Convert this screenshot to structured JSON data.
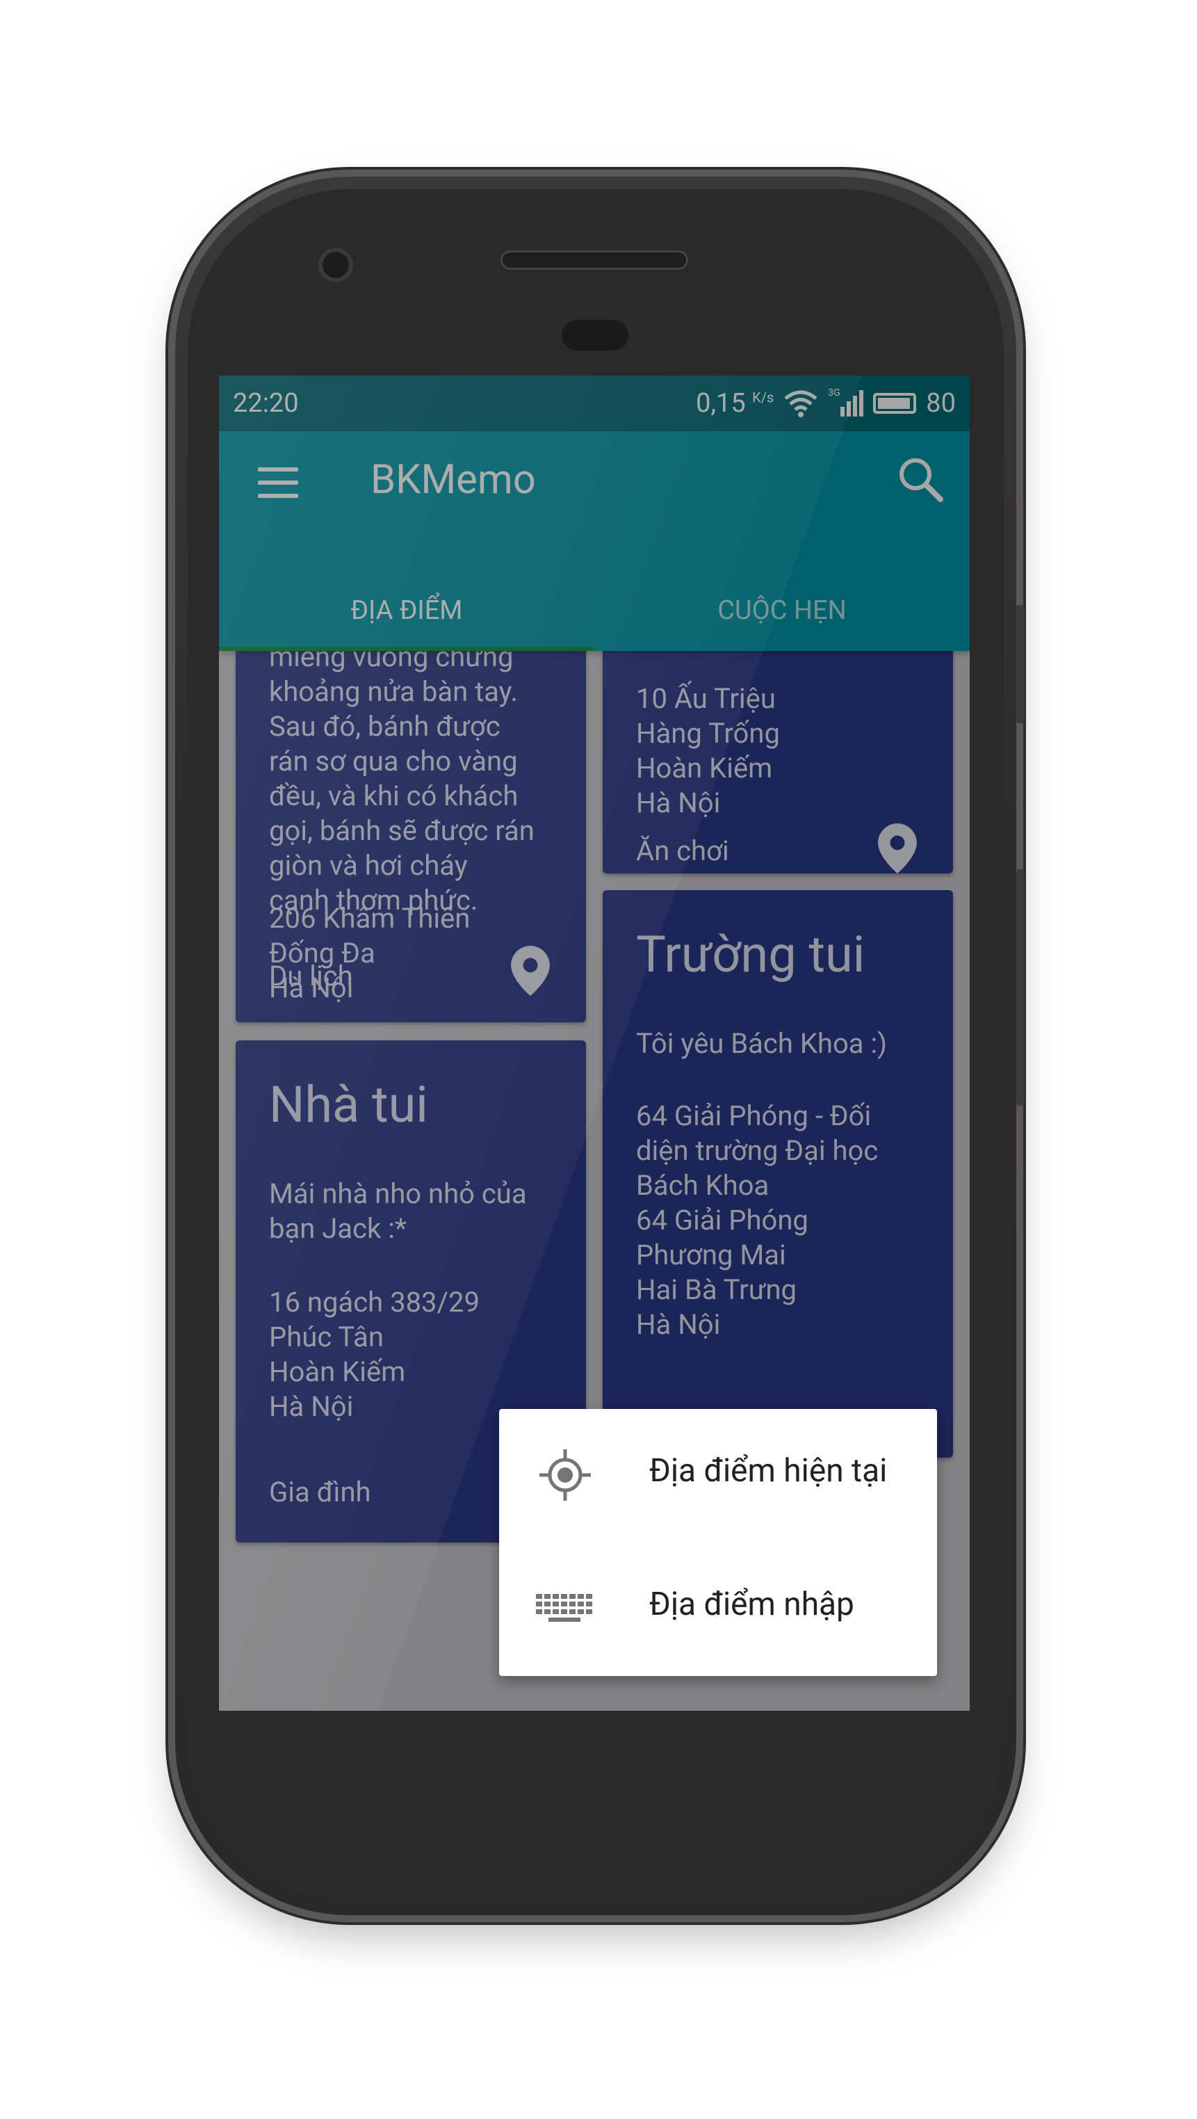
{
  "status_bar": {
    "time": "22:20",
    "speed": "0,15",
    "speed_unit": "K/s",
    "network": "3G",
    "battery": "80"
  },
  "app_bar": {
    "title": "BKMemo"
  },
  "tabs": [
    {
      "label": "ĐỊA ĐIỂM"
    },
    {
      "label": "CUỘC HẸN"
    }
  ],
  "cards": [
    {
      "description": "miếng vuông chừng\nkhoảng nửa bàn tay.\nSau đó, bánh được\nrán sơ qua cho vàng\nđều, và khi có khách\ngọi, bánh sẽ được rán\ngiòn và hơi cháy\ncạnh thơm phức.",
      "address": "206 Khâm Thiên\nĐống Đa\nHà Nội",
      "category": "Du lịch"
    },
    {
      "address": "10 Ấu Triệu\nHàng Trống\nHoàn Kiếm\nHà Nội",
      "category": "Ăn chơi"
    },
    {
      "title": "Nhà tui",
      "description": "Mái nhà nho nhỏ của\nbạn Jack :*",
      "address": "16 ngách 383/29\nPhúc Tân\nHoàn Kiếm\nHà Nội",
      "category": "Gia đình"
    },
    {
      "title": "Trường tui",
      "description": "Tôi yêu Bách Khoa :)",
      "address": "64 Giải Phóng - Đối\ndiện trường Đại học\nBách Khoa\n64 Giải Phóng\nPhương Mai\nHai Bà Trưng\nHà Nội"
    }
  ],
  "popup_menu": [
    {
      "label": "Địa điểm hiện tại",
      "icon": "gps-target-icon"
    },
    {
      "label": "Địa điểm nhập",
      "icon": "keyboard-icon"
    }
  ],
  "colors": {
    "status_bar": "#016b73",
    "app_bar": "#0096a6",
    "card": "#2b3a88",
    "tab_indicator": "#0b8a3a"
  }
}
